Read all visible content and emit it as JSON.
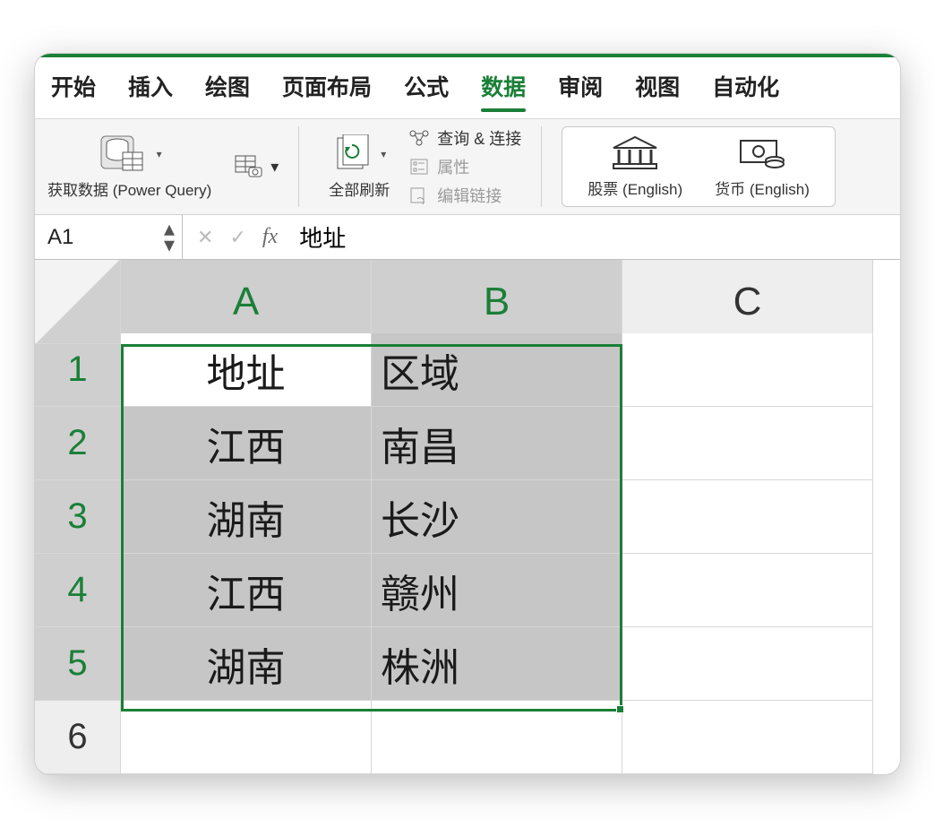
{
  "ribbon": {
    "tabs": [
      "开始",
      "插入",
      "绘图",
      "页面布局",
      "公式",
      "数据",
      "审阅",
      "视图",
      "自动化"
    ],
    "active_tab_index": 5,
    "groups": {
      "get_data": "获取数据 (Power Query)",
      "refresh_all": "全部刷新",
      "connections": {
        "queries": "查询 & 连接",
        "properties": "属性",
        "edit_links": "编辑链接"
      },
      "datatypes": {
        "stocks": "股票 (English)",
        "currency": "货币 (English)"
      }
    }
  },
  "namebox": "A1",
  "formula": "地址",
  "columns": [
    "A",
    "B",
    "C"
  ],
  "rows": [
    "1",
    "2",
    "3",
    "4",
    "5",
    "6"
  ],
  "cells": {
    "A1": "地址",
    "B1": "区域",
    "A2": "江西",
    "B2": "南昌",
    "A3": "湖南",
    "B3": "长沙",
    "A4": "江西",
    "B4": "赣州",
    "A5": "湖南",
    "B5": "株洲"
  },
  "selection": {
    "start": "A1",
    "end": "B5"
  }
}
